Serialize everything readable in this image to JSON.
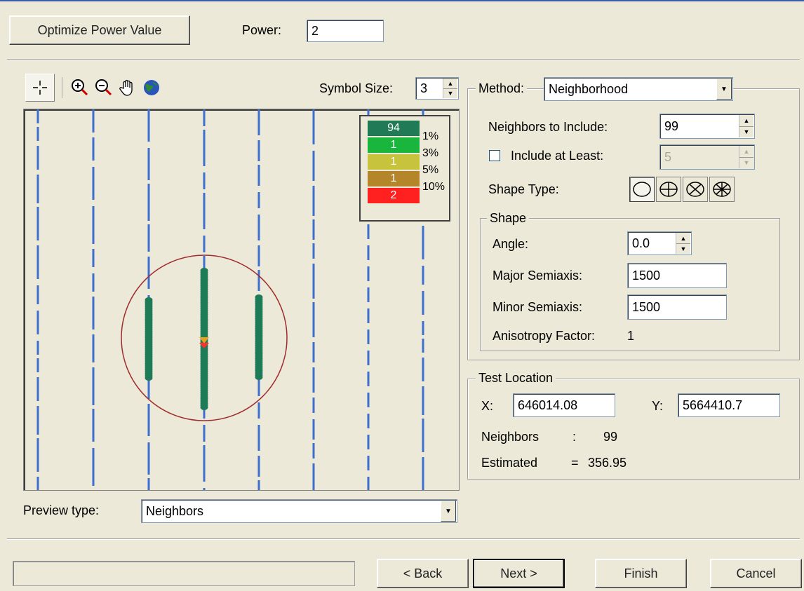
{
  "toolbar": {
    "optimize_label": "Optimize Power Value",
    "power_label": "Power:",
    "power_value": "2"
  },
  "preview": {
    "symbol_size_label": "Symbol Size:",
    "symbol_size_value": "3",
    "preview_type_label": "Preview type:",
    "preview_type_value": "Neighbors",
    "legend": [
      {
        "count": "94",
        "pct": "1%",
        "color": "#1f7a55"
      },
      {
        "count": "1",
        "pct": "3%",
        "color": "#19b53d"
      },
      {
        "count": "1",
        "pct": "5%",
        "color": "#c7c33c"
      },
      {
        "count": "1",
        "pct": "10%",
        "color": "#b5852a"
      },
      {
        "count": "2",
        "pct": "",
        "color": "#ff2020"
      }
    ],
    "colors": {
      "transect": "#3d6fd1",
      "point": "#1e7b57",
      "circle": "#a02c2c"
    }
  },
  "method": {
    "label": "Method:",
    "value": "Neighborhood",
    "neighbors_label": "Neighbors to Include:",
    "neighbors_value": "99",
    "include_least_label": "Include at Least:",
    "include_least_value": "5",
    "shape_type_label": "Shape Type:"
  },
  "shape": {
    "title": "Shape",
    "angle_label": "Angle:",
    "angle_value": "0.0",
    "major_label": "Major Semiaxis:",
    "major_value": "1500",
    "minor_label": "Minor Semiaxis:",
    "minor_value": "1500",
    "aniso_label": "Anisotropy Factor:",
    "aniso_value": "1"
  },
  "test_location": {
    "title": "Test Location",
    "x_label": "X:",
    "x_value": "646014.08",
    "y_label": "Y:",
    "y_value": "5664410.7",
    "neighbors_label": "Neighbors",
    "neighbors_sep": ":",
    "neighbors_value": "99",
    "estimated_label": "Estimated",
    "estimated_sep": "=",
    "estimated_value": "356.95"
  },
  "nav": {
    "back": "< Back",
    "next": "Next >",
    "finish": "Finish",
    "cancel": "Cancel"
  }
}
